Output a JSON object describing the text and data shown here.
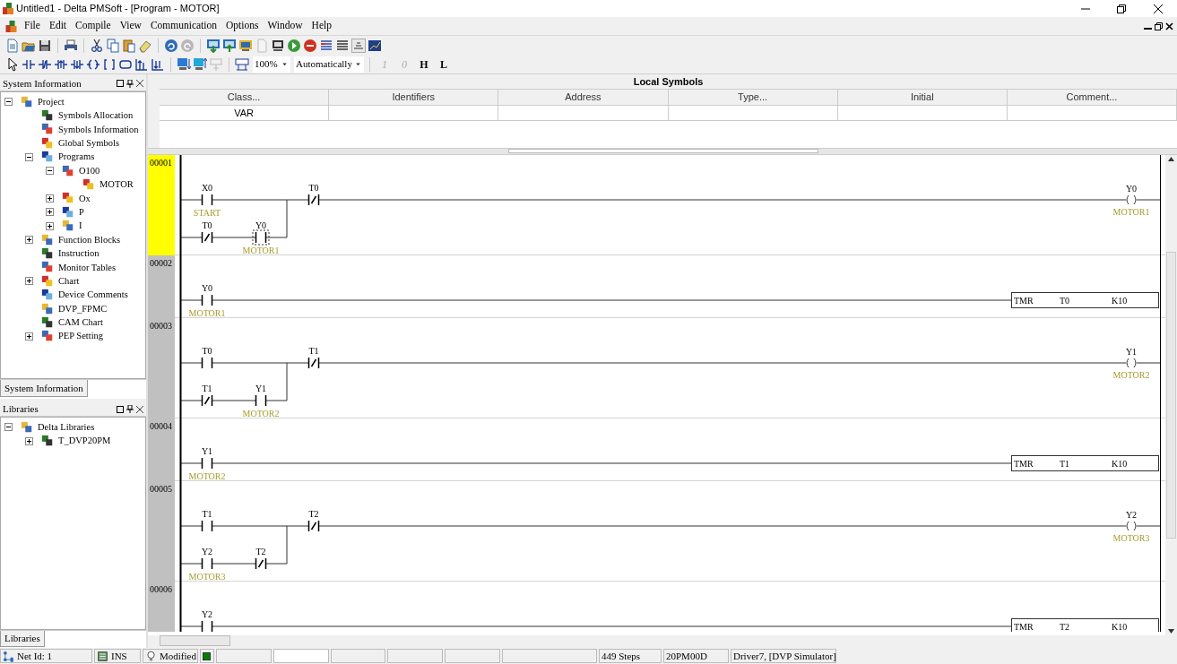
{
  "window": {
    "title": "Untitled1 - Delta PMSoft - [Program - MOTOR]"
  },
  "menu": [
    "File",
    "Edit",
    "Compile",
    "View",
    "Communication",
    "Options",
    "Window",
    "Help"
  ],
  "toolbar": {
    "zoom": "100%",
    "mode": "Automatically",
    "text_buttons": [
      {
        "label": "1",
        "disabled": true
      },
      {
        "label": "0",
        "disabled": true
      },
      {
        "label": "H",
        "disabled": false
      },
      {
        "label": "L",
        "disabled": false
      }
    ]
  },
  "system_panel": {
    "title": "System Information",
    "tab": "System Information",
    "tree": [
      {
        "label": "Project",
        "expanded": true,
        "children": [
          {
            "label": "Symbols Allocation"
          },
          {
            "label": "Symbols Information"
          },
          {
            "label": "Global Symbols"
          },
          {
            "label": "Programs",
            "expanded": true,
            "children": [
              {
                "label": "O100",
                "expanded": true,
                "children": [
                  {
                    "label": "MOTOR"
                  }
                ]
              },
              {
                "label": "Ox",
                "expanded": false
              },
              {
                "label": "P",
                "expanded": false
              },
              {
                "label": "I",
                "expanded": false
              }
            ]
          },
          {
            "label": "Function Blocks",
            "expanded": false
          },
          {
            "label": "Instruction"
          },
          {
            "label": "Monitor Tables"
          },
          {
            "label": "Chart",
            "expanded": false
          },
          {
            "label": "Device Comments"
          },
          {
            "label": "DVP_FPMC"
          },
          {
            "label": "CAM Chart"
          },
          {
            "label": "PEP Setting",
            "expanded": false
          }
        ]
      }
    ]
  },
  "libraries_panel": {
    "title": "Libraries",
    "tab": "Libraries",
    "tree": [
      {
        "label": "Delta Libraries",
        "expanded": true,
        "children": [
          {
            "label": "T_DVP20PM",
            "expanded": false
          }
        ]
      }
    ]
  },
  "local_symbols": {
    "title": "Local Symbols",
    "columns": [
      "Class...",
      "Identifiers",
      "Address",
      "Type...",
      "Initial",
      "Comment..."
    ],
    "rows": [
      [
        "VAR"
      ]
    ]
  },
  "ladder": {
    "rungs": [
      {
        "number": "00001",
        "selected": true,
        "branches": [
          [
            {
              "kind": "no",
              "address": "X0",
              "comment": "START",
              "selected": false
            }
          ],
          [
            {
              "kind": "nc",
              "address": "T0",
              "selected": false
            },
            {
              "kind": "no",
              "address": "Y0",
              "comment": "MOTOR1",
              "selected": true
            }
          ]
        ],
        "after": [
          {
            "kind": "nc",
            "address": "T0",
            "selected": false
          }
        ],
        "output": {
          "kind": "coil",
          "address": "Y0",
          "comment": "MOTOR1"
        }
      },
      {
        "number": "00002",
        "selected": false,
        "branches": [
          [
            {
              "kind": "no",
              "address": "Y0",
              "comment": "MOTOR1",
              "selected": false
            }
          ]
        ],
        "output": {
          "kind": "timer",
          "instruction": "TMR",
          "operands": [
            "T0",
            "K10"
          ]
        }
      },
      {
        "number": "00003",
        "selected": false,
        "branches": [
          [
            {
              "kind": "no",
              "address": "T0",
              "selected": false
            }
          ],
          [
            {
              "kind": "nc",
              "address": "T1",
              "selected": false
            },
            {
              "kind": "no",
              "address": "Y1",
              "comment": "MOTOR2",
              "selected": false
            }
          ]
        ],
        "after": [
          {
            "kind": "nc",
            "address": "T1",
            "selected": false
          }
        ],
        "output": {
          "kind": "coil",
          "address": "Y1",
          "comment": "MOTOR2"
        }
      },
      {
        "number": "00004",
        "selected": false,
        "branches": [
          [
            {
              "kind": "no",
              "address": "Y1",
              "comment": "MOTOR2",
              "selected": false
            }
          ]
        ],
        "output": {
          "kind": "timer",
          "instruction": "TMR",
          "operands": [
            "T1",
            "K10"
          ]
        }
      },
      {
        "number": "00005",
        "selected": false,
        "branches": [
          [
            {
              "kind": "no",
              "address": "T1",
              "selected": false
            }
          ],
          [
            {
              "kind": "no",
              "address": "Y2",
              "comment": "MOTOR3",
              "selected": false
            },
            {
              "kind": "nc",
              "address": "T2",
              "selected": false
            }
          ]
        ],
        "after": [
          {
            "kind": "nc",
            "address": "T2",
            "selected": false
          }
        ],
        "output": {
          "kind": "coil",
          "address": "Y2",
          "comment": "MOTOR3"
        }
      },
      {
        "number": "00006",
        "selected": false,
        "branches": [
          [
            {
              "kind": "no",
              "address": "Y2",
              "selected": false
            }
          ]
        ],
        "output": {
          "kind": "timer",
          "instruction": "TMR",
          "operands": [
            "T2",
            "K10"
          ]
        }
      }
    ]
  },
  "status_bar": [
    {
      "kind": "text",
      "text": "Net Id: 1"
    },
    {
      "kind": "text",
      "text": "INS"
    },
    {
      "kind": "text",
      "text": "Modified"
    },
    {
      "kind": "indicator",
      "color": "#008000"
    },
    {
      "kind": "blank"
    },
    {
      "kind": "field"
    },
    {
      "kind": "blank"
    },
    {
      "kind": "blank"
    },
    {
      "kind": "blank"
    },
    {
      "kind": "blank"
    },
    {
      "kind": "text",
      "text": "449 Steps"
    },
    {
      "kind": "text",
      "text": "20PM00D"
    },
    {
      "kind": "text",
      "text": "Driver7, [DVP Simulator]"
    }
  ]
}
